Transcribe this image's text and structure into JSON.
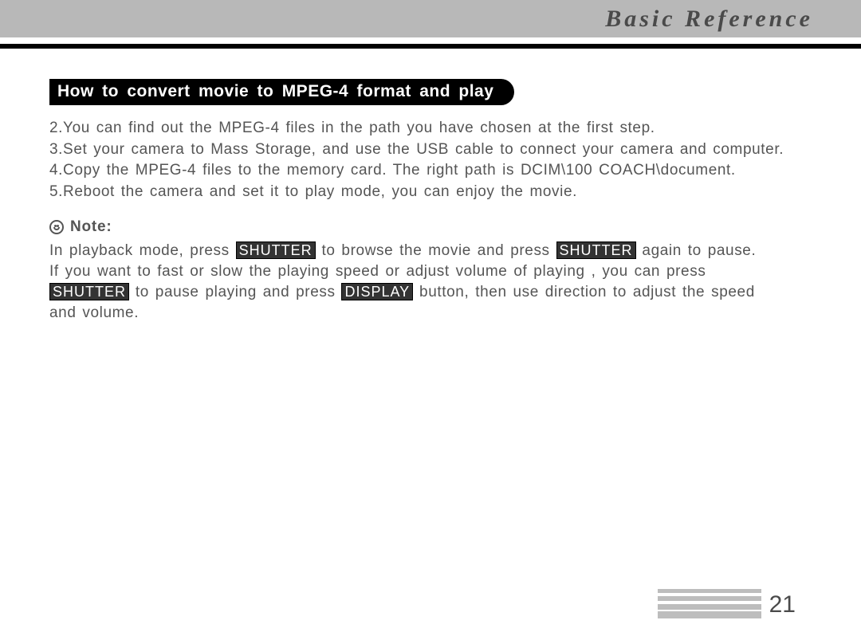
{
  "header": {
    "title": "Basic Reference"
  },
  "section": {
    "heading": "How to convert movie to MPEG-4 format and play"
  },
  "steps": {
    "s2": "2.You can find out the MPEG-4 files in the path you have chosen at the first step.",
    "s3": "3.Set your camera to Mass Storage, and use the USB cable to connect your camera and computer.",
    "s4": "4.Copy the MPEG-4 files to the memory card. The right path is DCIM\\100 COACH\\document.",
    "s5": "5.Reboot the camera and set it to play mode, you can enjoy the movie."
  },
  "note": {
    "label": "Note:",
    "line1a": "In playback mode, press ",
    "btn_shutter": "SHUTTER",
    "line1b": " to browse the movie and press ",
    "line1c": " again to pause.",
    "line2a": "If you want to fast or slow the playing speed or adjust volume of playing , you can press",
    "line3b": " to pause playing and press ",
    "btn_display": "DISPLAY",
    "line3c": " button, then use direction to adjust the speed",
    "line4": "and volume."
  },
  "footer": {
    "page": "21"
  }
}
